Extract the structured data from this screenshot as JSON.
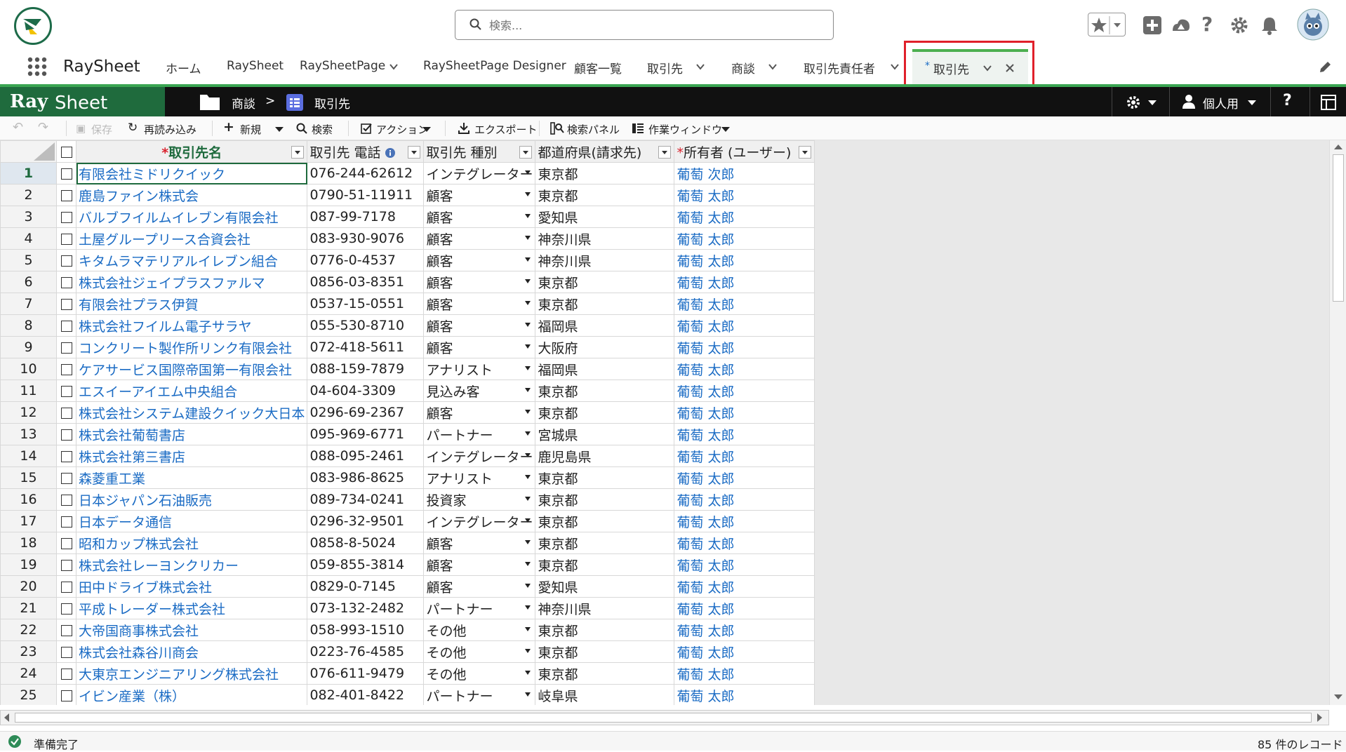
{
  "header": {
    "search_placeholder": "検索..."
  },
  "nav": {
    "app_name": "RaySheet",
    "items": [
      {
        "label": "ホーム",
        "has_menu": false
      },
      {
        "label": "RaySheet",
        "has_menu": false
      },
      {
        "label": "RaySheetPage",
        "has_menu": true
      },
      {
        "label": "RaySheetPage Designer",
        "has_menu": false
      },
      {
        "label": "顧客一覧",
        "has_menu": false
      },
      {
        "label": "取引先",
        "has_menu": true
      },
      {
        "label": "商談",
        "has_menu": true
      },
      {
        "label": "取引先責任者",
        "has_menu": true
      }
    ],
    "active_tab": {
      "marker": "*",
      "label": "取引先"
    }
  },
  "raysheet_bar": {
    "logo_ray": "Ray",
    "logo_sheet": "Sheet",
    "breadcrumb_parent": "商談",
    "breadcrumb_sep": ">",
    "breadcrumb_current": "取引先",
    "personal_label": "個人用",
    "help_label": "?"
  },
  "toolbar": {
    "save": "保存",
    "reload": "再読み込み",
    "new": "新規",
    "search": "検索",
    "action": "アクション",
    "export": "エクスポート",
    "search_panel": "検索パネル",
    "work_window": "作業ウィンドウ"
  },
  "grid": {
    "columns": [
      {
        "label": "取引先名",
        "required": true
      },
      {
        "label": "取引先 電話",
        "info": true
      },
      {
        "label": "取引先 種別"
      },
      {
        "label": "都道府県(請求先)"
      },
      {
        "label": "所有者 (ユーザー)",
        "required": true
      }
    ],
    "rows": [
      [
        "1",
        "有限会社ミドリクイック",
        "076-244-62612",
        "インテグレーター",
        "東京都",
        "葡萄 次郎"
      ],
      [
        "2",
        "鹿島ファイン株式会",
        "0790-51-11911",
        "顧客",
        "東京都",
        "葡萄 太郎"
      ],
      [
        "3",
        "バルブフイルムイレブン有限会社",
        "087-99-7178",
        "顧客",
        "愛知県",
        "葡萄 太郎"
      ],
      [
        "4",
        "土屋グループリース合資会社",
        "083-930-9076",
        "顧客",
        "神奈川県",
        "葡萄 太郎"
      ],
      [
        "5",
        "キタムラマテリアルイレブン組合",
        "0776-0-4537",
        "顧客",
        "神奈川県",
        "葡萄 太郎"
      ],
      [
        "6",
        "株式会社ジェイプラスファルマ",
        "0856-03-8351",
        "顧客",
        "東京都",
        "葡萄 太郎"
      ],
      [
        "7",
        "有限会社プラス伊賀",
        "0537-15-0551",
        "顧客",
        "東京都",
        "葡萄 太郎"
      ],
      [
        "8",
        "株式会社フイルム電子サラヤ",
        "055-530-8710",
        "顧客",
        "福岡県",
        "葡萄 太郎"
      ],
      [
        "9",
        "コンクリート製作所リンク有限会社",
        "072-418-5611",
        "顧客",
        "大阪府",
        "葡萄 太郎"
      ],
      [
        "10",
        "ケアサービス国際帝国第一有限会社",
        "088-159-7879",
        "アナリスト",
        "福岡県",
        "葡萄 太郎"
      ],
      [
        "11",
        "エスイーアイエム中央組合",
        "04-604-3309",
        "見込み客",
        "東京都",
        "葡萄 太郎"
      ],
      [
        "12",
        "株式会社システム建設クイック大日本",
        "0296-69-2367",
        "顧客",
        "東京都",
        "葡萄 太郎"
      ],
      [
        "13",
        "株式会社葡萄書店",
        "095-969-6771",
        "パートナー",
        "宮城県",
        "葡萄 太郎"
      ],
      [
        "14",
        "株式会社第三書店",
        "088-095-2461",
        "インテグレーター",
        "鹿児島県",
        "葡萄 太郎"
      ],
      [
        "15",
        "森菱重工業",
        "083-986-8625",
        "アナリスト",
        "東京都",
        "葡萄 太郎"
      ],
      [
        "16",
        "日本ジャパン石油販売",
        "089-734-0241",
        "投資家",
        "東京都",
        "葡萄 太郎"
      ],
      [
        "17",
        "日本データ通信",
        "0296-32-9501",
        "インテグレーター",
        "東京都",
        "葡萄 太郎"
      ],
      [
        "18",
        "昭和カップ株式会社",
        "0858-8-5024",
        "顧客",
        "東京都",
        "葡萄 太郎"
      ],
      [
        "19",
        "株式会社レーヨンクリカー",
        "059-855-3814",
        "顧客",
        "東京都",
        "葡萄 太郎"
      ],
      [
        "20",
        "田中ドライブ株式会社",
        "0829-0-7145",
        "顧客",
        "愛知県",
        "葡萄 太郎"
      ],
      [
        "21",
        "平成トレーダー株式会社",
        "073-132-2482",
        "パートナー",
        "神奈川県",
        "葡萄 太郎"
      ],
      [
        "22",
        "大帝国商事株式会社",
        "058-993-1510",
        "その他",
        "東京都",
        "葡萄 太郎"
      ],
      [
        "23",
        "株式会社森谷川商会",
        "0223-76-4585",
        "その他",
        "東京都",
        "葡萄 太郎"
      ],
      [
        "24",
        "大東京エンジニアリング株式会社",
        "076-611-9479",
        "その他",
        "東京都",
        "葡萄 太郎"
      ],
      [
        "25",
        "イビン産業（株）",
        "082-401-8422",
        "パートナー",
        "岐阜県",
        "葡萄 太郎"
      ]
    ],
    "selected_row": "1"
  },
  "status": {
    "text": "準備完了",
    "record_count": "85 件のレコード"
  },
  "colors": {
    "accent_green": "#3aa552",
    "link_blue": "#1a6bc4",
    "highlight_red": "#e0202a"
  }
}
